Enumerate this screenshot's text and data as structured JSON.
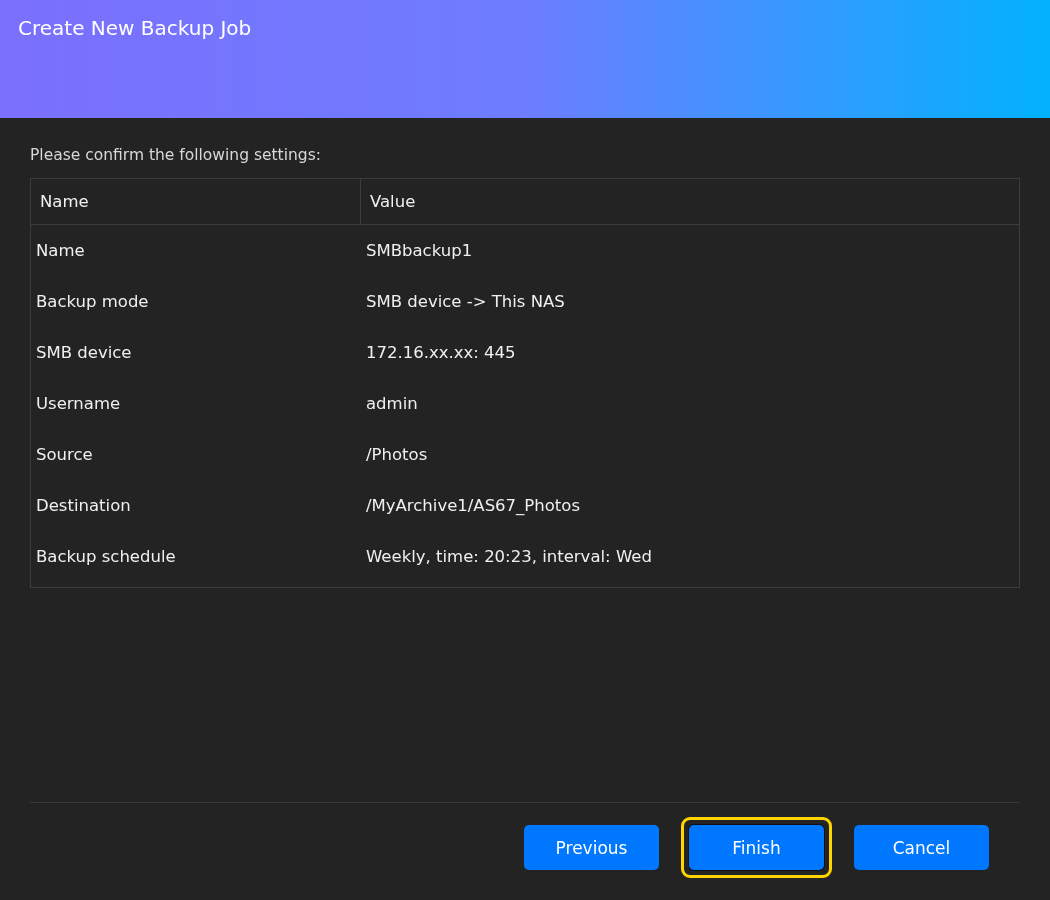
{
  "window": {
    "title": "Create New Backup Job"
  },
  "instruction": "Please confirm the following settings:",
  "table": {
    "columns": [
      "Name",
      "Value"
    ],
    "rows": [
      {
        "name": "Name",
        "value": "SMBbackup1"
      },
      {
        "name": "Backup mode",
        "value": "SMB device -> This NAS"
      },
      {
        "name": "SMB device",
        "value": "172.16.xx.xx: 445"
      },
      {
        "name": "Username",
        "value": "admin"
      },
      {
        "name": "Source",
        "value": "/Photos"
      },
      {
        "name": "Destination",
        "value": "/MyArchive1/AS67_Photos"
      },
      {
        "name": "Backup schedule",
        "value": "Weekly, time: 20:23, interval: Wed"
      }
    ]
  },
  "buttons": [
    {
      "label": "Previous",
      "highlighted": false
    },
    {
      "label": "Finish",
      "highlighted": true
    },
    {
      "label": "Cancel",
      "highlighted": false
    }
  ]
}
